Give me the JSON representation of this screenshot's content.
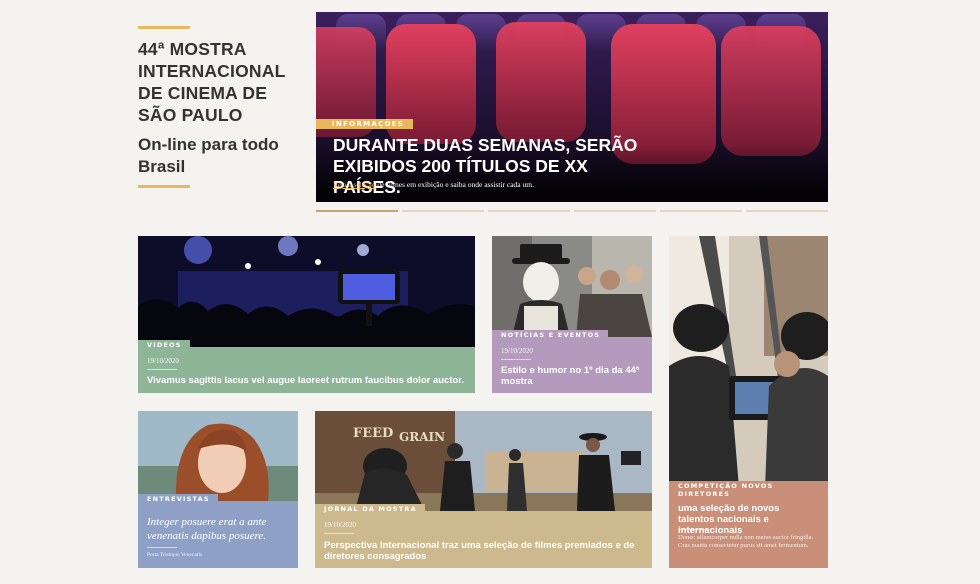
{
  "festival": {
    "title": "44ª MOSTRA INTERNACIONAL DE CINEMA DE SÃO PAULO",
    "subtitle": "On-line para todo Brasil"
  },
  "hero": {
    "category": "INFORMAÇÕES",
    "headline": "DURANTE DUAS SEMANAS, SERÃO EXIBIDOS 200 TÍTULOS DE XX PAÍSES.",
    "link_text": "Veja a seleção",
    "sub_text": " de filmes em exibição e saiba onde assistir cada um.",
    "slides": 6,
    "active_slide": 1
  },
  "cards": {
    "videos": {
      "category": "VIDEOS",
      "date": "19/10/2020",
      "headline": "Vivamus sagittis lacus vel augue laoreet rutrum faucibus dolor auctor."
    },
    "news": {
      "category": "NOTÍCIAS E EVENTOS",
      "date": "19/10/2020",
      "headline": "Estilo e humor no 1º dia da 44ª mostra"
    },
    "competition": {
      "category": "COMPETIÇÃO NOVOS DIRETORES",
      "headline": "uma  seleção de novos talentos nacionais e internacionais",
      "excerpt": "Donec ullamcorper nulla non metus auctor fringilla. Cras mattis consectetur purus sit amet fermentum."
    },
    "interviews": {
      "category": "ENTREVISTAS",
      "quote": "Integer posuere erat a ante venenatis dapibus posuere.",
      "author": "Porta Tristique Venenatis"
    },
    "journal": {
      "category": "JORNAL DA MOSTRA",
      "date": "19/10/2020",
      "headline": "Perspectiva Internacional traz uma seleção de filmes premiados e de diretores consagrados"
    }
  },
  "colors": {
    "accent": "#e9b75c",
    "videos": "#8fb598",
    "news": "#b49bbd",
    "competition": "#c98f79",
    "interviews": "#8fa0c7",
    "journal": "#cdb98e"
  }
}
